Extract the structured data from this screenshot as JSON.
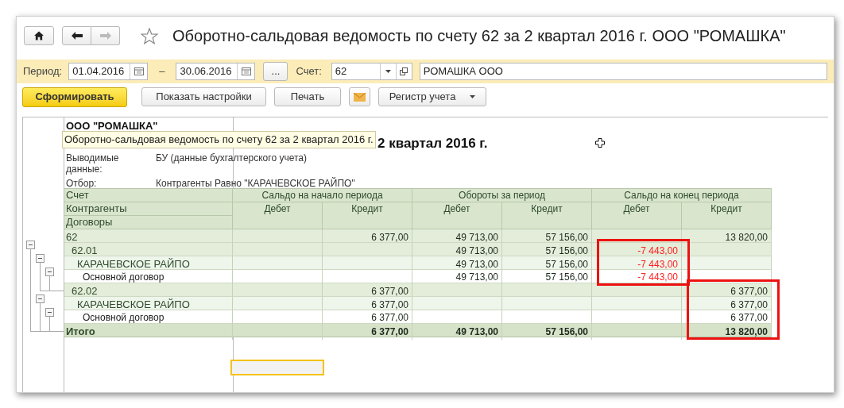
{
  "window": {
    "title": "Оборотно-сальдовая ведомость по счету 62 за 2 квартал 2016 г. ООО \"РОМАШКА\"",
    "favorite": false,
    "back_disabled": false,
    "forward_disabled": true
  },
  "filters": {
    "period_label": "Период:",
    "date_from": "01.04.2016",
    "dash": "–",
    "date_to": "30.06.2016",
    "ellipsis": "...",
    "account_label": "Счет:",
    "account": "62",
    "organization": "РОМАШКА ООО"
  },
  "commands": [
    {
      "kind": "primary",
      "label": "Сформировать"
    },
    {
      "kind": "plain",
      "label": "Показать настройки"
    },
    {
      "kind": "plain",
      "label": "Печать"
    },
    {
      "kind": "mail"
    },
    {
      "kind": "menu",
      "label": "Регистр учета"
    }
  ],
  "report": {
    "company": "ООО \"РОМАШКА\"",
    "title_visible": "2 квартал 2016 г.",
    "tooltip": "Оборотно-сальдовая ведомость по счету 62 за 2 квартал 2016 г.",
    "info": [
      {
        "label": "Выводимые данные:",
        "value": "БУ (данные бухгалтерского учета)"
      },
      {
        "label": "Отбор:",
        "value": "Контрагенты Равно \"КАРАЧЕВСКОЕ РАЙПО\""
      }
    ],
    "account_headers": [
      "Счет",
      "Контрагенты",
      "Договоры"
    ],
    "groups": [
      {
        "label": "Сальдо на начало периода",
        "subs": [
          "Дебет",
          "Кредит"
        ]
      },
      {
        "label": "Обороты за период",
        "subs": [
          "Дебет",
          "Кредит"
        ]
      },
      {
        "label": "Сальдо на конец периода",
        "subs": [
          "Дебет",
          "Кредит"
        ]
      }
    ],
    "rows": [
      {
        "name": "62",
        "expanded": true,
        "cells": [
          null,
          {
            "text": "6 377,00",
            "negative": false,
            "marked": false
          },
          {
            "text": "49 713,00",
            "negative": false,
            "marked": false
          },
          {
            "text": "57 156,00",
            "negative": false,
            "marked": false
          },
          null,
          {
            "text": "13 820,00",
            "negative": false,
            "marked": false
          }
        ],
        "children": [
          {
            "name": "62.01",
            "expanded": true,
            "cells": [
              null,
              null,
              {
                "text": "49 713,00",
                "negative": false,
                "marked": false
              },
              {
                "text": "57 156,00",
                "negative": false,
                "marked": false
              },
              {
                "text": "-7 443,00",
                "negative": true,
                "marked": true
              },
              null
            ],
            "children": [
              {
                "name": "КАРАЧЕВСКОЕ РАЙПО",
                "expanded": true,
                "cells": [
                  null,
                  null,
                  {
                    "text": "49 713,00",
                    "negative": false,
                    "marked": false
                  },
                  {
                    "text": "57 156,00",
                    "negative": false,
                    "marked": false
                  },
                  {
                    "text": "-7 443,00",
                    "negative": true,
                    "marked": true
                  },
                  null
                ],
                "children": [
                  {
                    "name": "Основной договор",
                    "cells": [
                      null,
                      null,
                      {
                        "text": "49 713,00",
                        "negative": false,
                        "marked": false
                      },
                      {
                        "text": "57 156,00",
                        "negative": false,
                        "marked": false
                      },
                      {
                        "text": "-7 443,00",
                        "negative": true,
                        "marked": true
                      },
                      null
                    ]
                  }
                ]
              }
            ]
          },
          {
            "name": "62.02",
            "expanded": true,
            "cells": [
              null,
              {
                "text": "6 377,00",
                "negative": false,
                "marked": false
              },
              null,
              null,
              null,
              {
                "text": "6 377,00",
                "negative": false,
                "marked": true
              }
            ],
            "children": [
              {
                "name": "КАРАЧЕВСКОЕ РАЙПО",
                "expanded": true,
                "cells": [
                  null,
                  {
                    "text": "6 377,00",
                    "negative": false,
                    "marked": false
                  },
                  null,
                  null,
                  null,
                  {
                    "text": "6 377,00",
                    "negative": false,
                    "marked": true
                  }
                ],
                "children": [
                  {
                    "name": "Основной договор",
                    "cells": [
                      null,
                      {
                        "text": "6 377,00",
                        "negative": false,
                        "marked": false
                      },
                      null,
                      null,
                      null,
                      {
                        "text": "6 377,00",
                        "negative": false,
                        "marked": true
                      }
                    ]
                  }
                ]
              }
            ]
          }
        ]
      }
    ],
    "total": {
      "name": "Итого",
      "cells": [
        null,
        {
          "text": "6 377,00",
          "negative": false,
          "marked": false
        },
        {
          "text": "49 713,00",
          "negative": false,
          "marked": false
        },
        {
          "text": "57 156,00",
          "negative": false,
          "marked": false
        },
        null,
        {
          "text": "13 820,00",
          "negative": false,
          "marked": true
        }
      ]
    },
    "cursor_cell": true
  }
}
